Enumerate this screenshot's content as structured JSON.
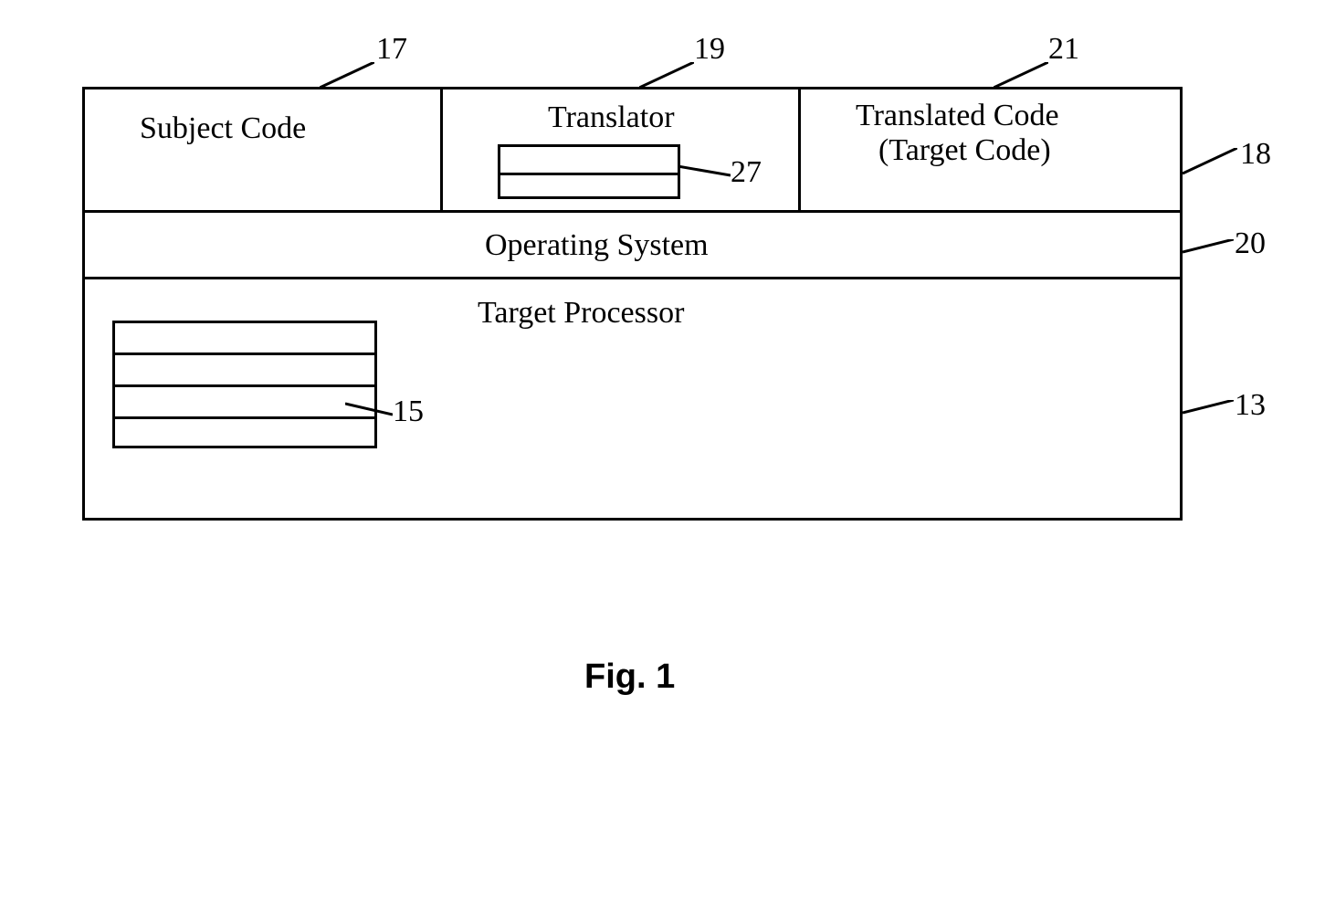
{
  "boxes": {
    "subject_code": {
      "label": "Subject Code",
      "ref": "17"
    },
    "translator": {
      "label": "Translator",
      "ref": "19",
      "inner_ref": "27"
    },
    "translated": {
      "label": "Translated Code",
      "label2": "(Target Code)",
      "ref": "21"
    },
    "top_row": {
      "ref": "18"
    },
    "os": {
      "label": "Operating System",
      "ref": "20"
    },
    "processor": {
      "label": "Target Processor",
      "ref": "13",
      "inner_ref": "15"
    }
  },
  "caption": "Fig. 1"
}
